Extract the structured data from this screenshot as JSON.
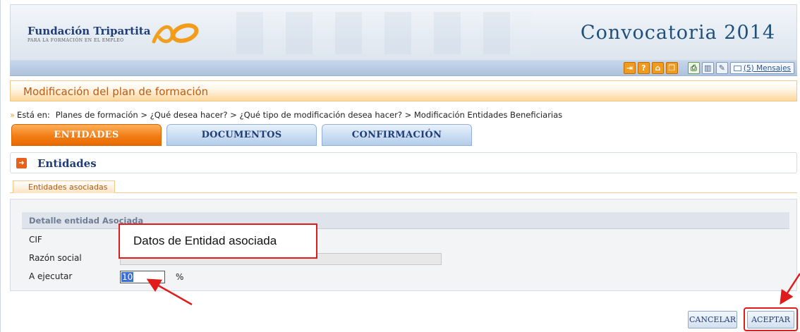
{
  "header": {
    "org_name": "Fundación Tripartita",
    "org_sub": "PARA LA FORMACIÓN EN EL EMPLEO",
    "title": "Convocatoria 2014"
  },
  "toolbar": {
    "messages_label": "(5) Mensajes"
  },
  "section": {
    "title": "Modificación del plan de formación"
  },
  "breadcrumb": {
    "label": "Está en:",
    "path": "Planes de formación > ¿Qué desea hacer? > ¿Qué tipo de modificación desea hacer? > Modificación Entidades Beneficiarias"
  },
  "tabs": [
    {
      "label": "ENTIDADES",
      "active": true
    },
    {
      "label": "DOCUMENTOS",
      "active": false
    },
    {
      "label": "CONFIRMACIÓN",
      "active": false
    }
  ],
  "entidades": {
    "title": "Entidades",
    "subtab": "Entidades asociadas"
  },
  "detail": {
    "title": "Detalle entidad Asociada",
    "fields": {
      "cif_label": "CIF",
      "razon_label": "Razón social",
      "ejecutar_label": "A ejecutar",
      "ejecutar_value": "10",
      "ejecutar_unit": "%"
    }
  },
  "callout": {
    "text": "Datos de Entidad asociada"
  },
  "buttons": {
    "cancel": "CANCELAR",
    "accept": "ACEPTAR"
  },
  "colors": {
    "accent_orange": "#f27d16",
    "brand_blue": "#1f3d78",
    "annotation_red": "#e01b1b"
  }
}
